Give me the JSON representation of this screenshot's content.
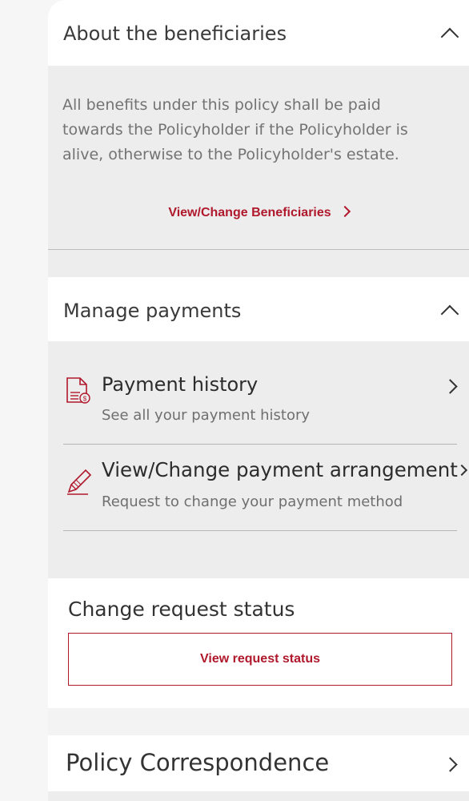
{
  "beneficiaries": {
    "title": "About the beneficiaries",
    "description": "All benefits under this policy shall be paid towards the Policyholder if the Policyholder is alive, otherwise to the Policyholder's estate.",
    "link_label": "View/Change Beneficiaries"
  },
  "payments": {
    "title": "Manage payments",
    "items": [
      {
        "title": "Payment history",
        "subtitle": "See all your payment history",
        "icon": "document-dollar-icon"
      },
      {
        "title": "View/Change payment arrangement",
        "subtitle": "Request to change your payment method",
        "icon": "pencil-icon"
      }
    ]
  },
  "change_request": {
    "title": "Change request status",
    "button_label": "View request status"
  },
  "correspondence": {
    "title": "Policy Correspondence"
  },
  "colors": {
    "accent": "#b0182c",
    "panel_grey": "#ededee",
    "background": "#f6f6f7"
  }
}
